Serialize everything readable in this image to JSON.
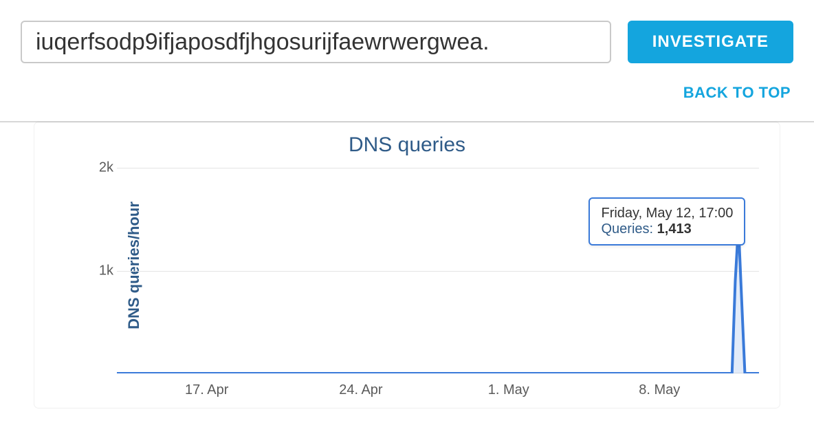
{
  "search": {
    "value": "iuqerfsodp9ifjaposdfjhgosurijfaewrwergwea."
  },
  "toolbar": {
    "investigate_label": "INVESTIGATE"
  },
  "links": {
    "back_to_top": "BACK TO TOP"
  },
  "chart": {
    "title": "DNS queries",
    "yaxis_title": "DNS queries/hour",
    "y_ticks": [
      "2k",
      "1k"
    ],
    "x_ticks": [
      "17. Apr",
      "24. Apr",
      "1. May",
      "8. May"
    ]
  },
  "tooltip": {
    "timestamp": "Friday, May 12, 17:00",
    "queries_label": "Queries",
    "queries_sep": ": ",
    "queries_value": "1,413"
  },
  "chart_data": {
    "type": "line",
    "title": "DNS queries",
    "xlabel": "",
    "ylabel": "DNS queries/hour",
    "ylim": [
      0,
      2000
    ],
    "x_tick_labels": [
      "17. Apr",
      "24. Apr",
      "1. May",
      "8. May"
    ],
    "x": [
      "2017-04-13",
      "2017-04-17",
      "2017-04-24",
      "2017-05-01",
      "2017-05-08",
      "2017-05-12T12:00",
      "2017-05-12T15:00",
      "2017-05-12T17:00",
      "2017-05-12T19:00",
      "2017-05-13T00:00"
    ],
    "series": [
      {
        "name": "Queries",
        "values": [
          0,
          0,
          0,
          0,
          0,
          0,
          900,
          1413,
          700,
          0
        ]
      }
    ],
    "highlight": {
      "x": "2017-05-12T17:00",
      "value": 1413,
      "label": "Friday, May 12, 17:00"
    }
  }
}
